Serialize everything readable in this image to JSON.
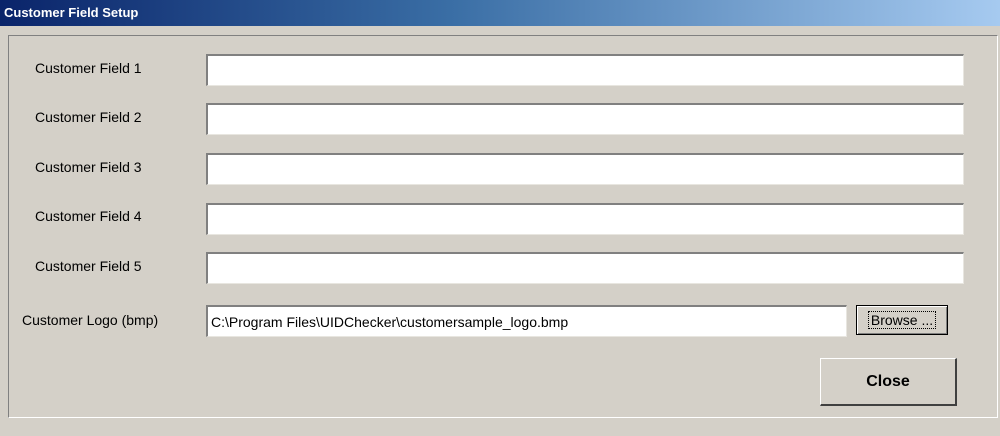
{
  "window": {
    "title": "Customer Field Setup"
  },
  "fields": [
    {
      "label": "Customer Field 1",
      "value": ""
    },
    {
      "label": "Customer Field 2",
      "value": ""
    },
    {
      "label": "Customer Field 3",
      "value": ""
    },
    {
      "label": "Customer Field 4",
      "value": ""
    },
    {
      "label": "Customer Field 5",
      "value": ""
    }
  ],
  "logo": {
    "label": "Customer Logo (bmp)",
    "value": "C:\\Program Files\\UIDChecker\\customersample_logo.bmp",
    "browse_label": "Browse ..."
  },
  "actions": {
    "close_label": "Close"
  },
  "colors": {
    "title_gradient_start": "#0a246a",
    "title_gradient_end": "#a6caf0",
    "dialog_face": "#d4d0c8"
  }
}
